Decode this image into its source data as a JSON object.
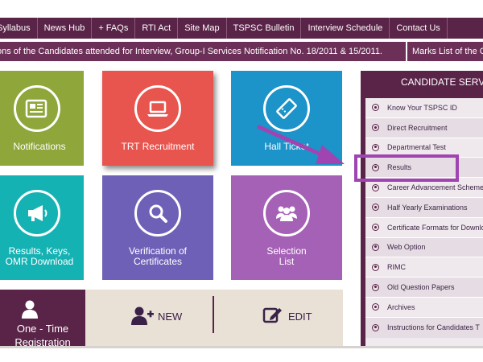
{
  "topnav": {
    "items": [
      "Syllabus",
      "News Hub",
      "+ FAQs",
      "RTI Act",
      "Site Map",
      "TSPSC Bulletin",
      "Interview Schedule",
      "Contact Us"
    ]
  },
  "ticker": {
    "text1": "ons of the Candidates attended for Interview, Group-I Services Notification No. 18/2011 & 15/2011.",
    "text2": "Marks List of the C"
  },
  "tiles": {
    "notifications": "Notifications",
    "trt": "TRT Recruitment",
    "hall": "Hall Ticket",
    "results_line1": "Results, Keys,",
    "results_line2": "OMR Download",
    "verif_line1": "Verification of",
    "verif_line2": "Certificates",
    "sel_line1": "Selection",
    "sel_line2": "List"
  },
  "otr": {
    "line1": "One - Time",
    "line2": "Registration"
  },
  "actions": {
    "new_label": "NEW",
    "edit_label": "EDIT"
  },
  "panel": {
    "title": "CANDIDATE SERVICES",
    "items": [
      "Know Your TSPSC ID",
      "Direct Recruitment",
      "Departmental Test",
      "Results",
      "Career Advancement Scheme",
      "Half Yearly Examinations",
      "Certificate Formats for Download",
      "Web Option",
      "RIMC",
      "Old Question Papers",
      "Archives",
      "Instructions for Candidates T"
    ]
  },
  "colors": {
    "brand": "#5a2348",
    "highlight": "#a044b2"
  }
}
